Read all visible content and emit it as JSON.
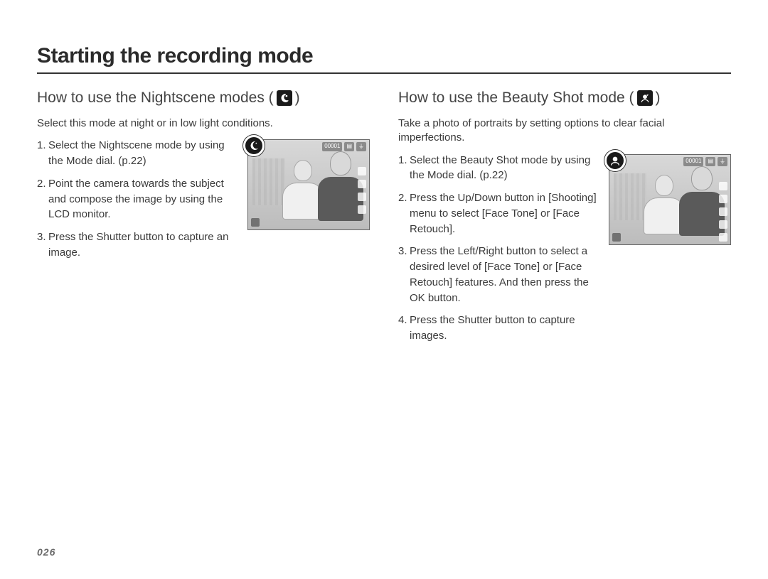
{
  "page_title": "Starting the recording mode",
  "page_number": "026",
  "left": {
    "heading_pre": "How to use the Nightscene modes (",
    "heading_post": " )",
    "icon": "nightscene-moon",
    "intro": "Select this mode at night or in low light conditions.",
    "thumb": {
      "mode_badge_icon": "nightscene-moon",
      "hud_tl": "⤢",
      "hud_tr": [
        "00001",
        "▤",
        "⏚"
      ]
    },
    "steps": [
      "Select the Nightscene mode by using the Mode dial. (p.22)",
      "Point the camera towards the subject and compose the image by using the LCD monitor.",
      "Press the Shutter button to capture an image."
    ]
  },
  "right": {
    "heading_pre": "How to use the Beauty Shot mode (",
    "heading_post": " )",
    "icon": "beauty-face",
    "intro": "Take a photo of portraits by setting options to clear facial imperfections.",
    "thumb": {
      "mode_badge_icon": "beauty-face",
      "hud_tl": "⤢",
      "hud_tr": [
        "00001",
        "▤",
        "⏚"
      ]
    },
    "steps": [
      "Select the Beauty Shot mode by using the Mode dial. (p.22)",
      "Press the Up/Down button in [Shooting] menu to select [Face Tone] or [Face Retouch].",
      "Press the Left/Right button to select a desired level of [Face Tone] or [Face Retouch] features. And then press the OK button.",
      "Press the Shutter button to capture images."
    ]
  }
}
